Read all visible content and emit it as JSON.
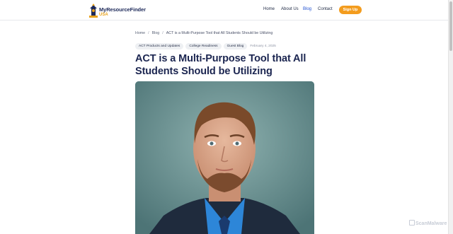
{
  "header": {
    "logo_text": "MyResourceFinder",
    "logo_sub": "USA",
    "nav": [
      {
        "label": "Home"
      },
      {
        "label": "About Us"
      },
      {
        "label": "Blog"
      },
      {
        "label": "Contact"
      }
    ],
    "signup_label": "Sign Up"
  },
  "breadcrumb": {
    "home": "Home",
    "blog": "Blog",
    "current": "ACT is a Multi-Purpose Tool that All Students Should be Utilizing",
    "separator": "/"
  },
  "article": {
    "tags": [
      "ACT Products and Updates",
      "College Readiness",
      "Guest Blog"
    ],
    "date": "February 4, 2025",
    "title": "ACT is a Multi-Purpose Tool that All Students Should be Utilizing"
  },
  "watermark": "ScanMalware",
  "colors": {
    "brand_navy": "#1b2550",
    "accent_orange": "#f39c1e",
    "active_nav": "#1f4fd1"
  }
}
